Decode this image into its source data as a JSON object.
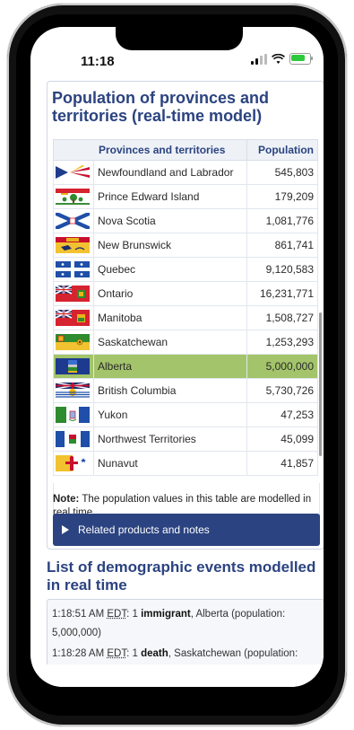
{
  "status": {
    "time": "11:18"
  },
  "card": {
    "title": "Population of provinces and territories (real-time model)",
    "table": {
      "headers": {
        "name": "Provinces and territories",
        "population": "Population"
      },
      "rows": [
        {
          "name": "Newfoundland and Labrador",
          "population": "545,803",
          "flag_icon": "newfoundland-flag-icon"
        },
        {
          "name": "Prince Edward Island",
          "population": "179,209",
          "flag_icon": "pei-flag-icon"
        },
        {
          "name": "Nova Scotia",
          "population": "1,081,776",
          "flag_icon": "nova-scotia-flag-icon"
        },
        {
          "name": "New Brunswick",
          "population": "861,741",
          "flag_icon": "new-brunswick-flag-icon"
        },
        {
          "name": "Quebec",
          "population": "9,120,583",
          "flag_icon": "quebec-flag-icon"
        },
        {
          "name": "Ontario",
          "population": "16,231,771",
          "flag_icon": "ontario-flag-icon"
        },
        {
          "name": "Manitoba",
          "population": "1,508,727",
          "flag_icon": "manitoba-flag-icon"
        },
        {
          "name": "Saskatchewan",
          "population": "1,253,293",
          "flag_icon": "saskatchewan-flag-icon"
        },
        {
          "name": "Alberta",
          "population": "5,000,000",
          "flag_icon": "alberta-flag-icon",
          "highlighted": true
        },
        {
          "name": "British Columbia",
          "population": "5,730,726",
          "flag_icon": "british-columbia-flag-icon"
        },
        {
          "name": "Yukon",
          "population": "47,253",
          "flag_icon": "yukon-flag-icon"
        },
        {
          "name": "Northwest Territories",
          "population": "45,099",
          "flag_icon": "nwt-flag-icon"
        },
        {
          "name": "Nunavut",
          "population": "41,857",
          "flag_icon": "nunavut-flag-icon"
        }
      ]
    },
    "note_label": "Note:",
    "note_text": "The population values in this table are modelled in real time.",
    "related_label": "Related products and notes"
  },
  "events": {
    "title": "List of demographic events modelled in real time",
    "items": [
      {
        "time": "1:18:51 AM",
        "zone": "EDT",
        "prefix": ": 1 ",
        "event": "immigrant",
        "suffix": ", Alberta (population: 5,000,000)"
      },
      {
        "time": "1:18:28 AM",
        "zone": "EDT",
        "prefix": ": 1 ",
        "event": "death",
        "suffix": ", Saskatchewan (population:"
      }
    ]
  },
  "colors": {
    "accent": "#2b4380",
    "highlight": "#a3c46a"
  }
}
